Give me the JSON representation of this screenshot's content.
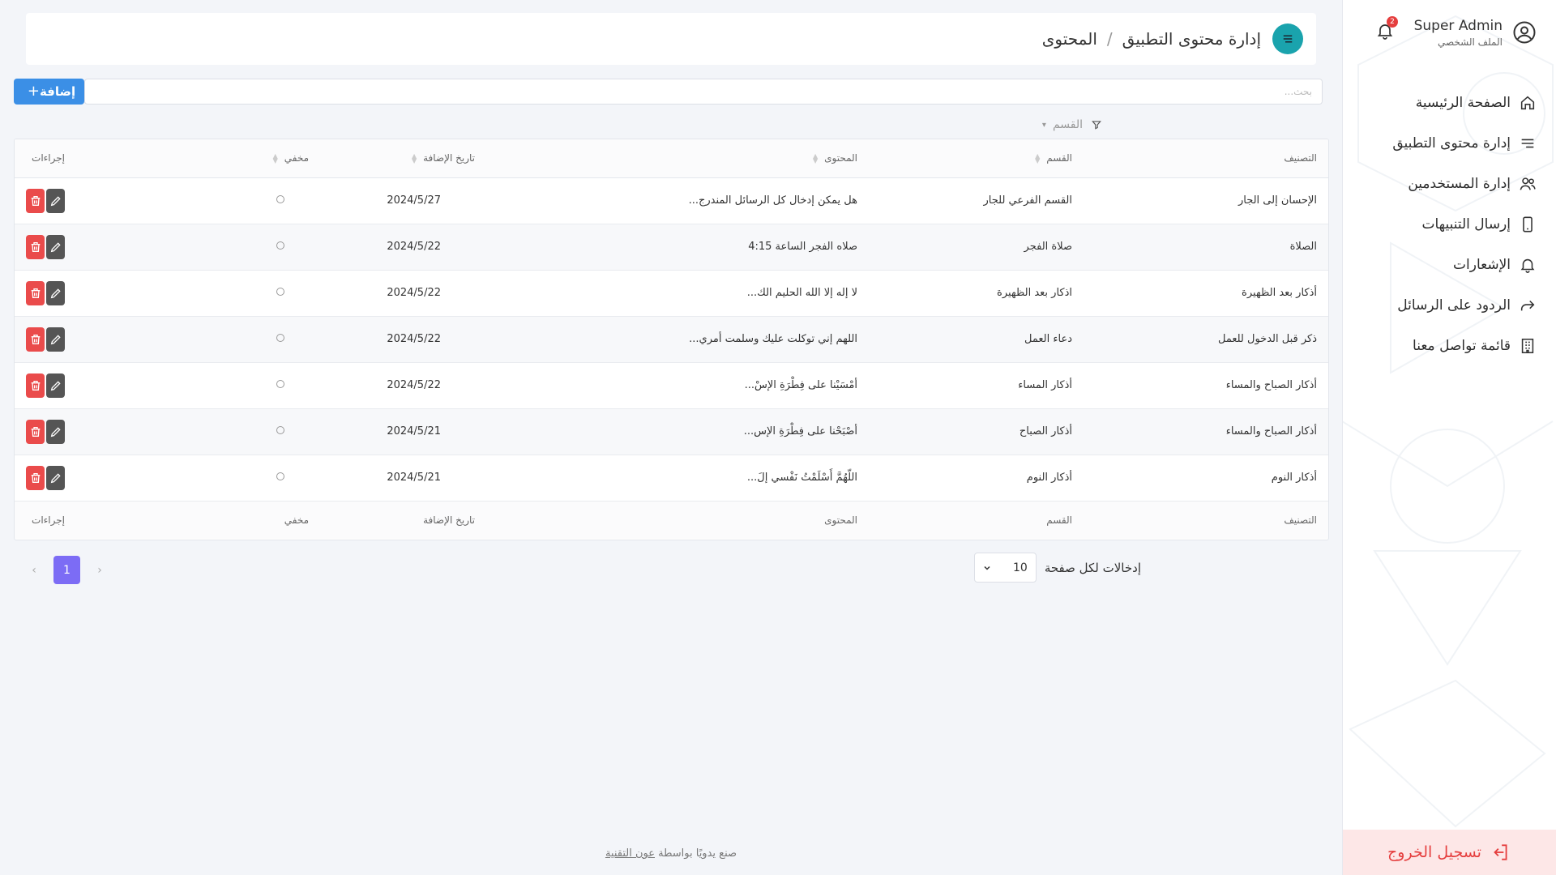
{
  "user": {
    "name": "Super Admin",
    "profile_label": "الملف الشخصي",
    "notifications_count": "2"
  },
  "sidebar": {
    "items": [
      {
        "label": "الصفحة الرئيسية",
        "icon": "home-icon"
      },
      {
        "label": "إدارة محتوى التطبيق",
        "icon": "lines-icon"
      },
      {
        "label": "إدارة المستخدمين",
        "icon": "users-icon"
      },
      {
        "label": "إرسال التنبيهات",
        "icon": "phone-icon"
      },
      {
        "label": "الإشعارات",
        "icon": "bell-icon"
      },
      {
        "label": "الردود على الرسائل",
        "icon": "reply-icon"
      },
      {
        "label": "قائمة تواصل معنا",
        "icon": "building-icon"
      }
    ],
    "logout_label": "تسجيل الخروج"
  },
  "breadcrumb": {
    "root": "إدارة محتوى التطبيق",
    "separator": "/",
    "current": "المحتوى"
  },
  "toolbar": {
    "add_label": "إضافة",
    "search_placeholder": "بحث..."
  },
  "filter": {
    "label": "القسم"
  },
  "table": {
    "headers": {
      "category": "التصنيف",
      "section": "القسم",
      "content": "المحتوى",
      "date": "تاريخ الإضافة",
      "hidden": "مخفي",
      "actions": "إجراءات"
    },
    "rows": [
      {
        "category": "الإحسان إلى الجار",
        "section": "القسم الفرعي للجار",
        "content": "هل يمكن إدخال كل الرسائل المندرج...",
        "date": "2024/5/27"
      },
      {
        "category": "الصلاة",
        "section": "صلاة الفجر",
        "content": "صلاه الفجر الساعة 4:15",
        "date": "2024/5/22"
      },
      {
        "category": "أذكار بعد الظهيرة",
        "section": "اذكار بعد الظهيرة",
        "content": "لا إله إلا الله الحليم الك...",
        "date": "2024/5/22"
      },
      {
        "category": "ذكر قبل الدخول للعمل",
        "section": "دعاء العمل",
        "content": "اللهم إني توكلت عليك وسلمت أمري...",
        "date": "2024/5/22"
      },
      {
        "category": "أذكار الصباح والمساء",
        "section": "أذكار المساء",
        "content": "أمْسَيْنا على فِطْرَةِ الإسْ...",
        "date": "2024/5/22"
      },
      {
        "category": "أذكار الصباح والمساء",
        "section": "أذكار الصباح",
        "content": "أصْبَحْنا على فِطْرَةِ الإس...",
        "date": "2024/5/21"
      },
      {
        "category": "أذكار النوم",
        "section": "أذكار النوم",
        "content": "اللّهُمَّ أَسْلَمْتُ نَفْسي إلَ...",
        "date": "2024/5/21"
      }
    ]
  },
  "pagination": {
    "current_page": "1",
    "per_page": "10",
    "per_page_label": "إدخالات لكل صفحة"
  },
  "footer": {
    "text": "صنع يدويًا بواسطة",
    "link": "عون التقنية"
  }
}
